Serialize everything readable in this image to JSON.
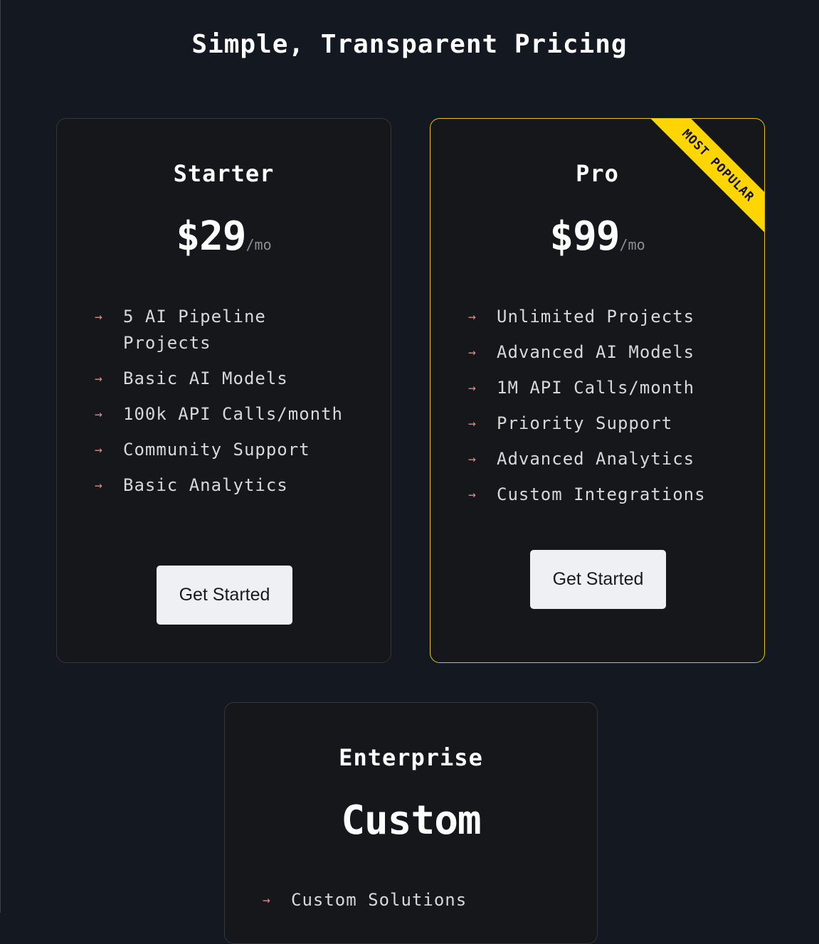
{
  "pricing": {
    "title": "Simple, Transparent Pricing",
    "plans": [
      {
        "name": "Starter",
        "price": "$29",
        "period": "/mo",
        "featured": false,
        "features": [
          "5 AI Pipeline Projects",
          "Basic AI Models",
          "100k API Calls/month",
          "Community Support",
          "Basic Analytics"
        ],
        "button_label": "Get Started"
      },
      {
        "name": "Pro",
        "price": "$99",
        "period": "/mo",
        "featured": true,
        "badge": "MOST POPULAR",
        "features": [
          "Unlimited Projects",
          "Advanced AI Models",
          "1M API Calls/month",
          "Priority Support",
          "Advanced Analytics",
          "Custom Integrations"
        ],
        "button_label": "Get Started"
      },
      {
        "name": "Enterprise",
        "price": "Custom",
        "featured": false,
        "features": [
          "Custom Solutions"
        ]
      }
    ]
  },
  "icons": {
    "feature_bullet": "arrow-right-icon"
  },
  "colors": {
    "background": "#131821",
    "card_background": "#16171b",
    "featured_border": "#e2c21a",
    "ribbon": "#ffd500",
    "bullet_arrow": "#e08b86",
    "button_background": "#eef0f4"
  }
}
